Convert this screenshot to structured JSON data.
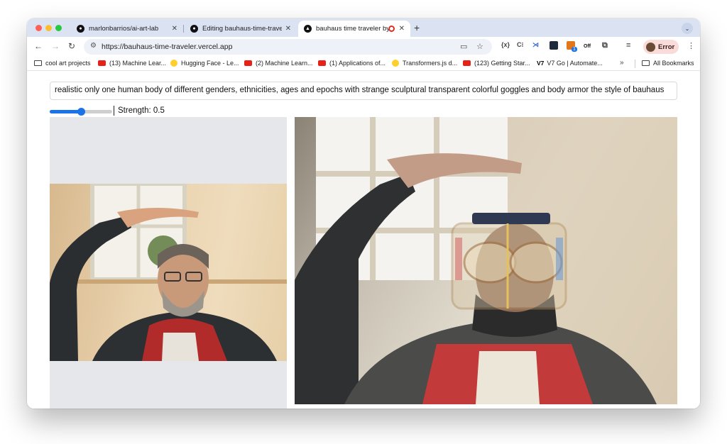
{
  "browser": {
    "tabs": [
      {
        "title": "marlonbarrios/ai-art-lab",
        "active": false,
        "favicon": "github-icon"
      },
      {
        "title": "Editing bauhaus-time-traveler",
        "active": false,
        "favicon": "github-icon"
      },
      {
        "title": "bauhaus time traveler by",
        "active": true,
        "favicon": "vercel-icon"
      }
    ],
    "new_tab": "+",
    "address": "https://bauhaus-time-traveler.vercel.app",
    "profile_label": "Error",
    "extension_badge": "1",
    "extension_off": "Off"
  },
  "bookmarks": [
    {
      "label": "cool art projects",
      "icon": "folder-icon"
    },
    {
      "label": "(13) Machine Lear...",
      "icon": "youtube-icon"
    },
    {
      "label": "Hugging Face - Le...",
      "icon": "huggingface-icon"
    },
    {
      "label": "(2) Machine Learn...",
      "icon": "youtube-icon"
    },
    {
      "label": "(1) Applications of...",
      "icon": "youtube-icon"
    },
    {
      "label": "Transformers.js d...",
      "icon": "huggingface-icon"
    },
    {
      "label": "(123) Getting Star...",
      "icon": "youtube-icon"
    },
    {
      "label": "V7 Go | Automate...",
      "icon": "v7-icon"
    }
  ],
  "bookmarks_more": "»",
  "all_bookmarks": "All Bookmarks",
  "page": {
    "prompt_value": "realistic only one human body of different   genders, ethnicities, ages and epochs with strange sculptural transparent  colorful goggles and body armor the style of bauhaus",
    "strength_label": "Strength: 0.5",
    "strength_value": 0.5
  },
  "colors": {
    "accent": "#1a73e8",
    "tabstrip": "#dbe3f3",
    "profile_bg": "#f9dcd9"
  }
}
